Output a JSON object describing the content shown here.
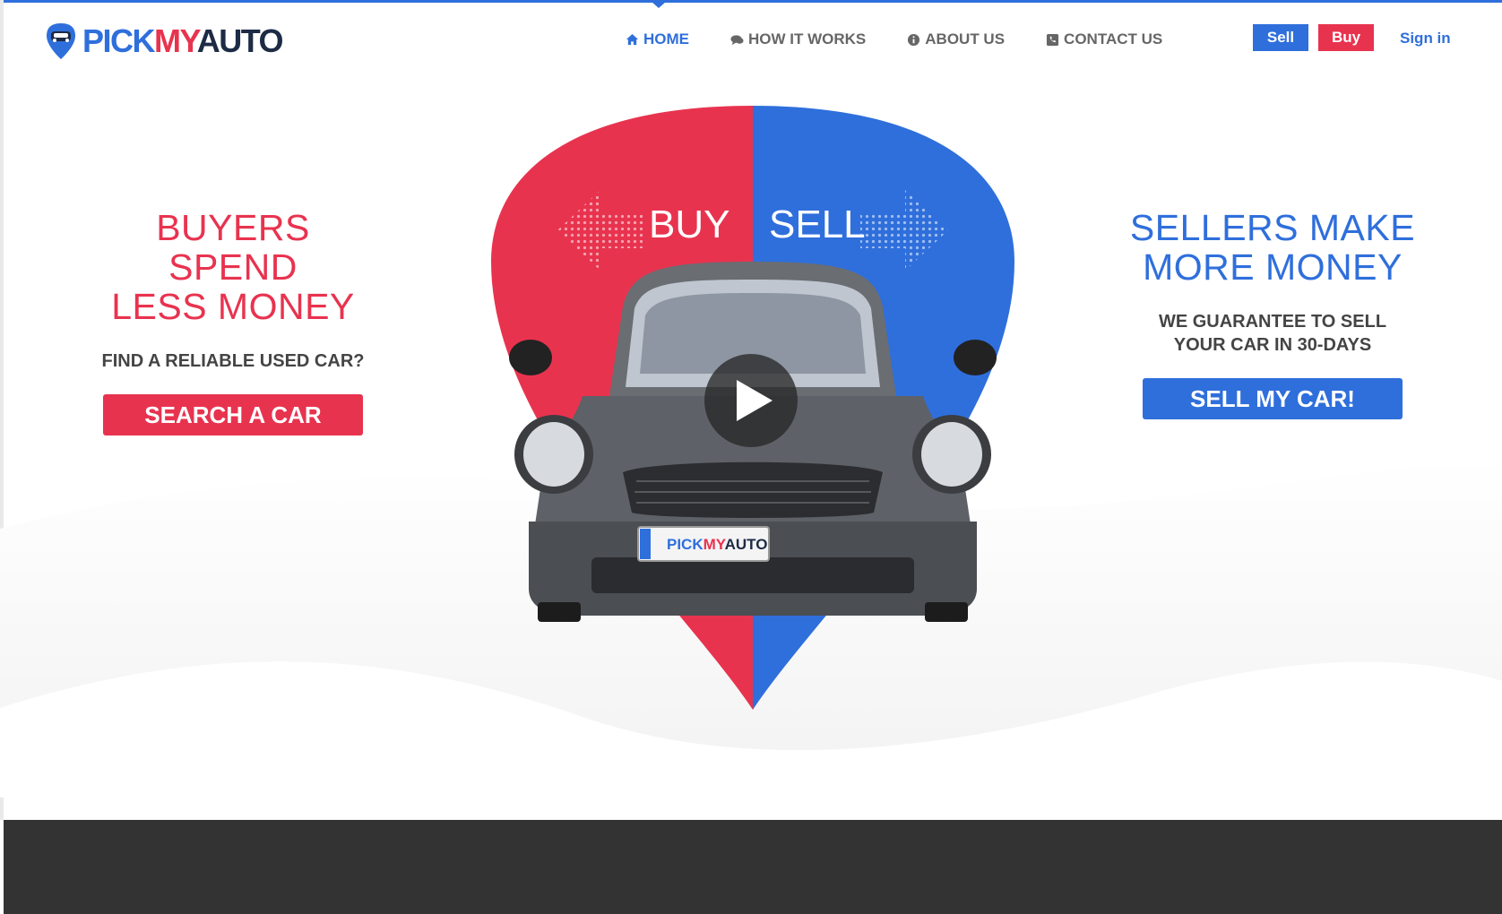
{
  "header": {
    "logo": {
      "part1": "PICK",
      "part2": "MY",
      "part3": "AUTO"
    },
    "nav": [
      {
        "label": "HOME",
        "icon": "home-icon",
        "active": true
      },
      {
        "label": "HOW IT WORKS",
        "icon": "comments-icon",
        "active": false
      },
      {
        "label": "ABOUT US",
        "icon": "info-circle-icon",
        "active": false
      },
      {
        "label": "CONTACT US",
        "icon": "phone-square-icon",
        "active": false
      }
    ],
    "sell_label": "Sell",
    "buy_label": "Buy",
    "signin_label": "Sign in"
  },
  "hero": {
    "left": {
      "headline_line1": "BUYERS SPEND",
      "headline_line2": "LESS MONEY",
      "subtitle": "FIND A RELIABLE USED CAR?",
      "cta": "SEARCH A CAR"
    },
    "center": {
      "buy_label": "BUY",
      "sell_label": "SELL",
      "plate_text": "PICKMYAUTO",
      "play_icon": "play-icon"
    },
    "right": {
      "headline_line1": "SELLERS MAKE",
      "headline_line2": "MORE MONEY",
      "subtitle_line1": "WE GUARANTEE TO SELL",
      "subtitle_line2": "YOUR CAR IN 30-DAYS",
      "cta": "SELL MY CAR!"
    }
  },
  "colors": {
    "brand_blue": "#2f6fdc",
    "brand_red": "#e8334f",
    "footer_bg": "#333333"
  }
}
